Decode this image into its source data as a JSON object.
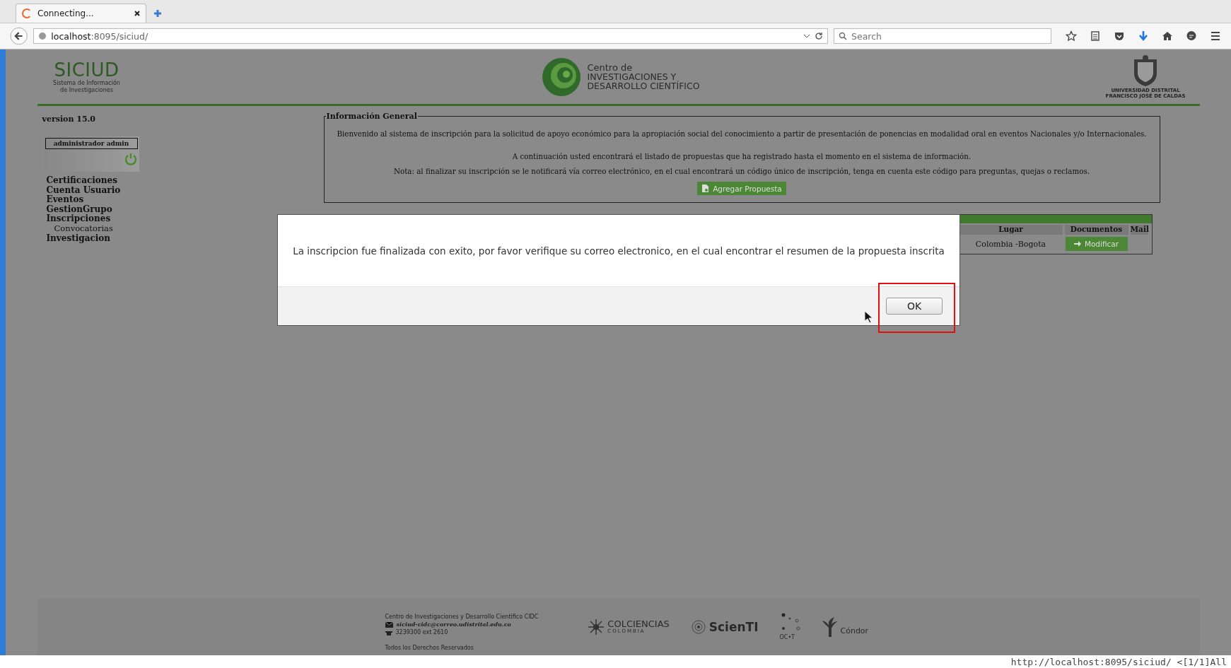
{
  "browser": {
    "tab": {
      "title": "Connecting...",
      "loading": true
    },
    "url": {
      "host": "localhost",
      "rest": ":8095/siciud/"
    },
    "search": {
      "placeholder": "Search"
    }
  },
  "header": {
    "logo": {
      "title": "SICIUD",
      "subtitle": [
        "Sistema de Información",
        "de Investigaciones"
      ]
    },
    "center": {
      "lines": [
        "Centro de",
        "INVESTIGACIONES Y",
        "DESARROLLO CIENTÍFICO"
      ]
    },
    "crest": {
      "lines": [
        "UNIVERSIDAD DISTRITAL",
        "FRANCISCO JOSÉ DE CALDAS"
      ]
    }
  },
  "version": "version 15.0",
  "user": "administrador admin",
  "menu": [
    {
      "label": "Certificaciones"
    },
    {
      "label": "Cuenta Usuario"
    },
    {
      "label": "Eventos"
    },
    {
      "label": "GestionGrupo"
    },
    {
      "label": "Inscripciones",
      "children": [
        {
          "label": "Convocatorias"
        }
      ]
    },
    {
      "label": "Investigacion"
    }
  ],
  "info": {
    "legend": "Información General",
    "paragraphs": [
      "Bienvenido al sistema de inscripción para la solicitud de apoyo económico para la apropiación social del conocimiento a partir de presentación de ponencias en modalidad oral en eventos Nacionales y/o Internacionales.",
      "A continuación usted encontrará el listado de propuestas que ha registrado hasta el momento en el sistema de información.",
      "Nota: al finalizar su inscripción se le notificará vía correo electrónico, en el cual encontrará un código único de inscripción, tenga en cuenta este código para preguntas, quejas o reclamos."
    ],
    "button": "Agregar Propuesta"
  },
  "table": {
    "columns": [
      "Lugar",
      "Documentos",
      "Mail"
    ],
    "rows": [
      {
        "lugar": "Colombia -Bogota",
        "action": "Modificar"
      }
    ]
  },
  "dialog": {
    "message": "La inscripcion fue finalizada con exito, por favor verifique su correo electronico, en el cual encontrar el resumen de la propuesta inscrita",
    "button": "OK",
    "highlighted": true
  },
  "footer": {
    "title": "Centro de Investigaciones y Desarrollo Cientifico CIDC",
    "email": "siciud-cidc@correo.udistrital.edu.co",
    "phone": "3239300 ext 2610",
    "rights": "Todos los Derechos Reservados",
    "logos": [
      {
        "kind": "colciencias",
        "name": "COLCIENCIAS",
        "sub": "COLOMBIA"
      },
      {
        "kind": "scienti",
        "name": "ScienTI"
      },
      {
        "kind": "ocyt",
        "name": "OC•T"
      },
      {
        "kind": "condor",
        "name": "Cóndor"
      }
    ]
  },
  "status_url": "http://localhost:8095/siciud/ <[1/1]All"
}
